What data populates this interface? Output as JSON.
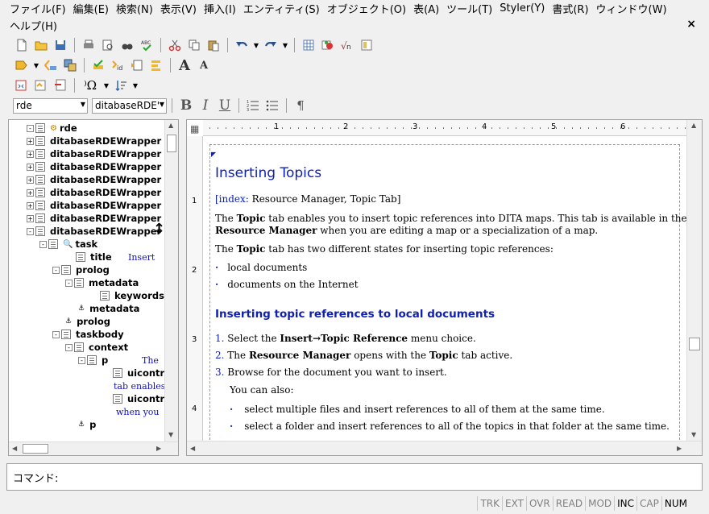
{
  "menu": {
    "row1": [
      "ファイル(F)",
      "編集(E)",
      "検索(N)",
      "表示(V)",
      "挿入(I)",
      "エンティティ(S)",
      "オブジェクト(O)",
      "表(A)",
      "ツール(T)",
      "Styler(Y)",
      "書式(R)",
      "ウィンドウ(W)"
    ],
    "row2": [
      "ヘルプ(H)"
    ],
    "close": "×"
  },
  "toolbar": {
    "element_combo": "rde",
    "style_combo": "ditabaseRDE'",
    "bold": "B",
    "italic": "I",
    "underline": "U",
    "pilcrow": "¶",
    "font_large": "A",
    "font_small": "A"
  },
  "tree": {
    "nodes": [
      {
        "label": "rde",
        "value": ""
      },
      {
        "label": "ditabaseRDEWrapper",
        "value": ""
      },
      {
        "label": "ditabaseRDEWrapper",
        "value": ""
      },
      {
        "label": "ditabaseRDEWrapper",
        "value": ""
      },
      {
        "label": "ditabaseRDEWrapper",
        "value": ""
      },
      {
        "label": "ditabaseRDEWrapper",
        "value": ""
      },
      {
        "label": "ditabaseRDEWrapper",
        "value": ""
      },
      {
        "label": "ditabaseRDEWrapper",
        "value": ""
      },
      {
        "label": "ditabaseRDEWrapper",
        "value": ""
      },
      {
        "label": "task",
        "value": ""
      },
      {
        "label": "title",
        "value": "Insert"
      },
      {
        "label": "prolog",
        "value": ""
      },
      {
        "label": "metadata",
        "value": ""
      },
      {
        "label": "keywords",
        "value": ""
      },
      {
        "label": "metadata",
        "value": ""
      },
      {
        "label": "prolog",
        "value": ""
      },
      {
        "label": "taskbody",
        "value": ""
      },
      {
        "label": "context",
        "value": ""
      },
      {
        "label": "p",
        "value": "The"
      },
      {
        "label": "uicontr",
        "value": ""
      },
      {
        "label": "",
        "value": "tab enables"
      },
      {
        "label": "uicontr",
        "value": ""
      },
      {
        "label": "",
        "value": "when you"
      },
      {
        "label": "p",
        "value": ""
      }
    ]
  },
  "ruler": {
    "h_labels": [
      "1",
      "2",
      "3",
      "4",
      "5",
      "6"
    ],
    "v_labels": [
      "1",
      "2",
      "3",
      "4"
    ]
  },
  "doc": {
    "title": "Inserting Topics",
    "index_label": "[index:",
    "index_text": "Resource Manager, Topic Tab]",
    "p1_a": "The ",
    "p1_b": "Topic",
    "p1_c": " tab enables you to insert topic references into DITA maps. This tab is available in the",
    "p1_d": "Resource Manager",
    "p1_e": " when you are editing a map or a specialization of a map.",
    "p2_a": "The ",
    "p2_b": "Topic",
    "p2_c": " tab has two different states for inserting topic references:",
    "bullet": "·",
    "li1": "local documents",
    "li2": "documents on the Internet",
    "h2": "Inserting topic references to local documents",
    "s1_num": "1.",
    "s1_a": "Select the ",
    "s1_b": "Insert→Topic Reference",
    "s1_c": " menu choice.",
    "s2_num": "2.",
    "s2_a": "The ",
    "s2_b": "Resource Manager",
    "s2_c": " opens with the ",
    "s2_d": "Topic",
    "s2_e": " tab active.",
    "s3_num": "3.",
    "s3_a": "Browse for the document you want to insert.",
    "also": "You can also:",
    "sub1": "select multiple files and insert references to all of them at the same time.",
    "sub2": "select a folder and insert references to all of the topics in that folder at the same time."
  },
  "command": {
    "label": "コマンド:"
  },
  "status": [
    {
      "label": "TRK",
      "on": false
    },
    {
      "label": "EXT",
      "on": false
    },
    {
      "label": "OVR",
      "on": false
    },
    {
      "label": "READ",
      "on": false
    },
    {
      "label": "MOD",
      "on": false
    },
    {
      "label": "INC",
      "on": true
    },
    {
      "label": "CAP",
      "on": false
    },
    {
      "label": "NUM",
      "on": true
    }
  ],
  "colors": {
    "accent_blue": "#1020b0",
    "panel_bg": "#f0f0f0"
  }
}
